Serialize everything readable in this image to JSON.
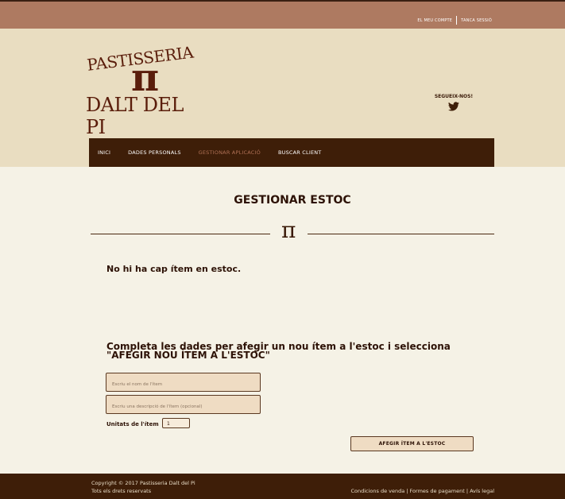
{
  "topbar": {
    "account_label": "EL MEU COMPTE",
    "logout_label": "TANCA SESSIÓ"
  },
  "logo": {
    "line1": "PASTISSERIA",
    "symbol": "π",
    "line2": "DALT DEL PI"
  },
  "social": {
    "label": "SEGUEIX-NOS!",
    "icon": "twitter-icon"
  },
  "nav": {
    "items": [
      {
        "label": "INICI"
      },
      {
        "label": "DADES PERSONALS"
      },
      {
        "label": "GESTIONAR APLICACIÓ"
      },
      {
        "label": "BUSCAR CLIENT"
      }
    ],
    "active_index": 2
  },
  "page": {
    "title": "GESTIONAR ESTOC",
    "divider_symbol": "π",
    "empty_message": "No hi ha cap ítem en estoc.",
    "instructions": "Completa les dades per afegir un nou ítem a l'estoc i selecciona \"AFEGIR NOU ÍTEM A L'ESTOC\""
  },
  "form": {
    "name_placeholder": "Escriu el nom de l'ítem",
    "description_placeholder": "Escriu una descripció de l'ítem (opcional)",
    "units_label": "Unitats de l'ítem",
    "units_value": "1",
    "submit_label": "AFEGIR ÍTEM A L'ESTOC"
  },
  "footer": {
    "copyright": "Copyright © 2017 Pastisseria Dalt del Pi",
    "rights": "Tots els drets reservats",
    "links": "Condicions de venda | Formes de pagament | Avís legal"
  },
  "colors": {
    "topbar": "#ae7a61",
    "header": "#e9ddc1",
    "nav": "#3e1e08",
    "nav_active": "#b07055",
    "background": "#f5f2e6",
    "field": "#efdcc3"
  }
}
